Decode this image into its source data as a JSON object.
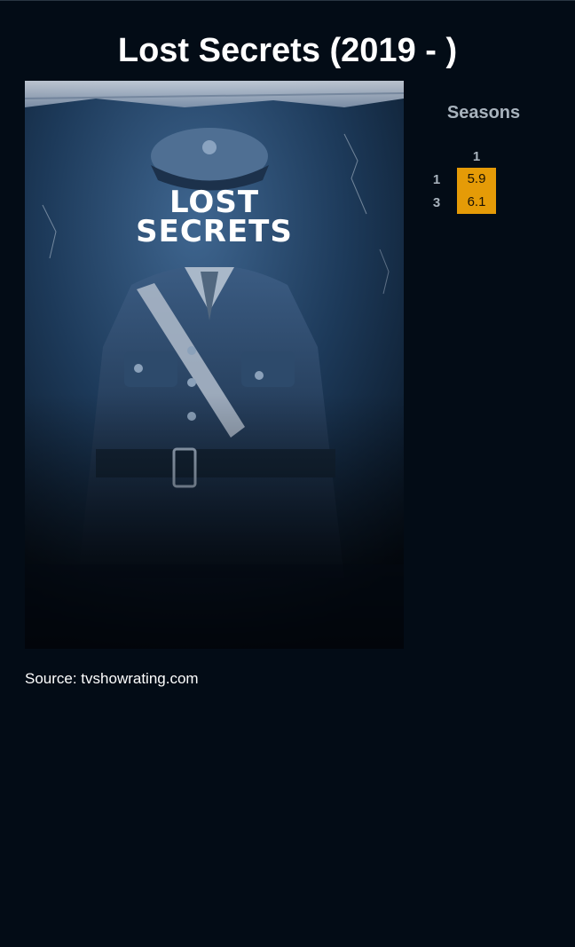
{
  "show": {
    "title": "Lost Secrets (2019 - )"
  },
  "poster": {
    "logo_line1": "LOST",
    "logo_line2": "SECRETS"
  },
  "ratings": {
    "heading": "Seasons",
    "season_columns": [
      "1"
    ],
    "rows": [
      {
        "episode": "1",
        "values": [
          "5.9"
        ]
      },
      {
        "episode": "3",
        "values": [
          "6.1"
        ]
      }
    ],
    "cell_color": "#e59b07"
  },
  "footer": {
    "source": "Source: tvshowrating.com"
  },
  "colors": {
    "background": "#030c16",
    "label_gray": "#a8b3bd"
  }
}
